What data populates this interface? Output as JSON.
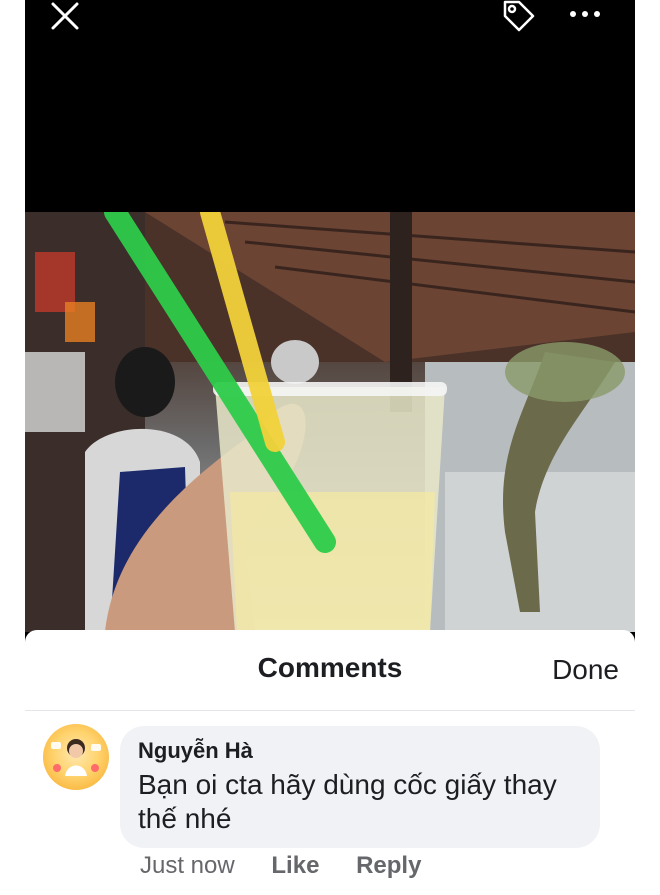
{
  "toolbar": {
    "close_icon": "close-icon",
    "tag_icon": "tag-icon",
    "more_icon": "more-icon"
  },
  "photo": {
    "description_icon": "photo"
  },
  "comments_sheet": {
    "title": "Comments",
    "done_label": "Done",
    "comments": [
      {
        "author": "Nguyễn Hà",
        "text": "Bạn oi cta hãy dùng cốc giấy thay thế nhé",
        "time": "Just now",
        "like_label": "Like",
        "reply_label": "Reply"
      }
    ]
  },
  "colors": {
    "sheet_bg": "#ffffff",
    "bubble_bg": "#f0f2f5",
    "text_primary": "#1c1e21",
    "text_secondary": "#65676b",
    "straw_green": "#2ecc4a",
    "straw_yellow": "#f2d23a"
  }
}
